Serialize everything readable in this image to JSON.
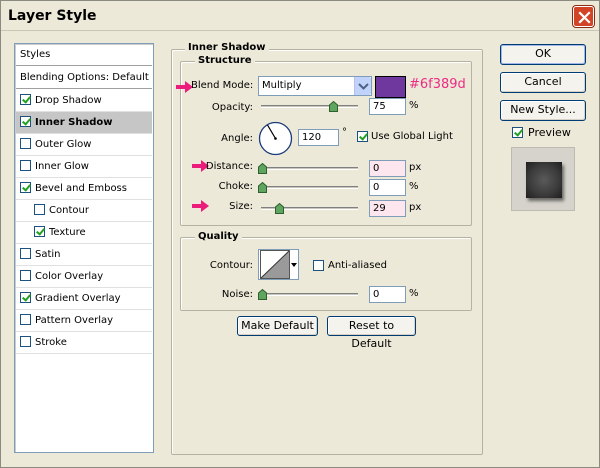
{
  "window": {
    "title": "Layer Style"
  },
  "styles_list": {
    "header": "Styles",
    "blending": "Blending Options: Default",
    "items": [
      {
        "label": "Drop Shadow",
        "checked": true
      },
      {
        "label": "Inner Shadow",
        "checked": true,
        "selected": true
      },
      {
        "label": "Outer Glow",
        "checked": false
      },
      {
        "label": "Inner Glow",
        "checked": false
      },
      {
        "label": "Bevel and Emboss",
        "checked": true
      },
      {
        "label": "Contour",
        "checked": false,
        "sub": true
      },
      {
        "label": "Texture",
        "checked": true,
        "sub": true
      },
      {
        "label": "Satin",
        "checked": false
      },
      {
        "label": "Color Overlay",
        "checked": false
      },
      {
        "label": "Gradient Overlay",
        "checked": true
      },
      {
        "label": "Pattern Overlay",
        "checked": false
      },
      {
        "label": "Stroke",
        "checked": false
      }
    ]
  },
  "inner_shadow": {
    "title": "Inner Shadow",
    "structure": {
      "title": "Structure",
      "blend_mode_label": "Blend Mode:",
      "blend_mode_value": "Multiply",
      "color": "#6f389f",
      "color_hex_label": "#6f389d",
      "opacity_label": "Opacity:",
      "opacity_value": "75",
      "opacity_unit": "%",
      "opacity_level": 0.75,
      "angle_label": "Angle:",
      "angle_value": "120",
      "angle_unit": "°",
      "use_global_light_label": "Use Global Light",
      "use_global_light": true,
      "distance_label": "Distance:",
      "distance_value": "0",
      "distance_unit": "px",
      "choke_label": "Choke:",
      "choke_value": "0",
      "choke_unit": "%",
      "size_label": "Size:",
      "size_value": "29",
      "size_unit": "px"
    },
    "quality": {
      "title": "Quality",
      "contour_label": "Contour:",
      "anti_aliased_label": "Anti-aliased",
      "anti_aliased": false,
      "noise_label": "Noise:",
      "noise_value": "0",
      "noise_unit": "%"
    },
    "make_default": "Make Default",
    "reset_default": "Reset to Default"
  },
  "actions": {
    "ok": "OK",
    "cancel": "Cancel",
    "new_style": "New Style...",
    "preview_label": "Preview",
    "preview_checked": true
  },
  "colors": {
    "highlight_arrow": "#ec1c7c",
    "selected_row": "#c6c6c6",
    "dialog_bg": "#ece9d8"
  }
}
